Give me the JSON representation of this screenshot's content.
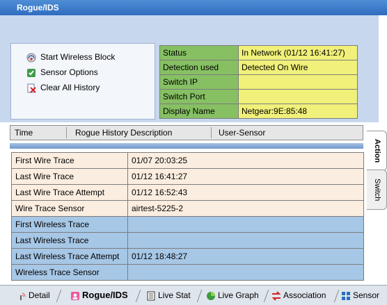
{
  "window": {
    "title": "Rogue/IDS"
  },
  "actions": [
    {
      "label": "Start Wireless Block",
      "icon": "wireless-block-icon"
    },
    {
      "label": "Sensor Options",
      "icon": "sensor-options-icon"
    },
    {
      "label": "Clear All History",
      "icon": "clear-history-icon"
    }
  ],
  "status": [
    {
      "key": "Status",
      "value": "In Network (01/12 16:41:27)"
    },
    {
      "key": "Detection used",
      "value": "Detected On Wire"
    },
    {
      "key": "Switch IP",
      "value": ""
    },
    {
      "key": "Switch Port",
      "value": ""
    },
    {
      "key": "Display Name",
      "value": "Netgear:9E:85:48"
    }
  ],
  "history": {
    "columns": [
      "Time",
      "Rogue History Description",
      "User-Sensor"
    ]
  },
  "traces": [
    {
      "key": "First Wire Trace",
      "value": "01/07 20:03:25",
      "kind": "wire"
    },
    {
      "key": "Last Wire Trace",
      "value": "01/12 16:41:27",
      "kind": "wire"
    },
    {
      "key": "Last Wire Trace Attempt",
      "value": "01/12 16:52:43",
      "kind": "wire"
    },
    {
      "key": "Wire Trace Sensor",
      "value": "airtest-5225-2",
      "kind": "wire"
    },
    {
      "key": "First Wireless Trace",
      "value": "",
      "kind": "wireless"
    },
    {
      "key": "Last Wireless Trace",
      "value": "",
      "kind": "wireless"
    },
    {
      "key": "Last Wireless Trace Attempt",
      "value": "01/12 18:48:27",
      "kind": "wireless"
    },
    {
      "key": "Wireless Trace Sensor",
      "value": "",
      "kind": "wireless"
    }
  ],
  "side_tabs": [
    {
      "label": "Action",
      "active": true
    },
    {
      "label": "Switch",
      "active": false
    }
  ],
  "bottom_tabs": [
    {
      "label": "Detail",
      "icon": "wireless-signal-icon",
      "active": false
    },
    {
      "label": "Rogue/IDS",
      "icon": "rogue-ids-icon",
      "active": true
    },
    {
      "label": "Live Stat",
      "icon": "live-stat-icon",
      "active": false
    },
    {
      "label": "Live Graph",
      "icon": "live-graph-icon",
      "active": false
    },
    {
      "label": "Association",
      "icon": "association-icon",
      "active": false
    },
    {
      "label": "Sensor",
      "icon": "sensor-icon",
      "active": false
    }
  ],
  "colors": {
    "title_bar": "#3a7bd5",
    "status_key_bg": "#86c063",
    "status_value_bg": "#f0f07a",
    "wire_row_bg": "#fbeee0",
    "wireless_row_bg": "#a7c7e6"
  }
}
